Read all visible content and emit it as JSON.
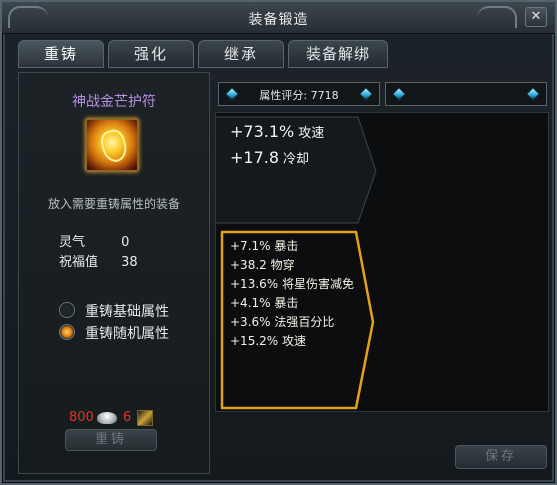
{
  "window": {
    "title": "装备锻造"
  },
  "tabs": [
    {
      "label": "重铸",
      "active": true
    },
    {
      "label": "强化",
      "active": false
    },
    {
      "label": "继承",
      "active": false
    },
    {
      "label": "装备解绑",
      "active": false
    }
  ],
  "item": {
    "name": "神战金芒护符",
    "icon": "golden-amulet-icon",
    "hint": "放入需要重铸属性的装备"
  },
  "stats": [
    {
      "label": "灵气",
      "value": "0"
    },
    {
      "label": "祝福值",
      "value": "38"
    }
  ],
  "options": [
    {
      "label": "重铸基础属性",
      "selected": false
    },
    {
      "label": "重铸随机属性",
      "selected": true
    }
  ],
  "cost": {
    "silver": "800",
    "stone": "6",
    "silver_icon": "silver-ingot-icon",
    "stone_icon": "reforge-stone-icon"
  },
  "reforge_button": "重铸",
  "score_bar": {
    "text": "属性评分: 7718"
  },
  "current_attrs": [
    {
      "value": "+73.1%",
      "name": "攻速"
    },
    {
      "value": "+17.8",
      "name": "冷却"
    }
  ],
  "new_attrs": [
    {
      "text": "+7.1%  暴击"
    },
    {
      "text": "+38.2  物穿"
    },
    {
      "text": "+13.6%  将星伤害减免"
    },
    {
      "text": "+4.1%  暴击"
    },
    {
      "text": "+3.6%  法强百分比"
    },
    {
      "text": "+15.2%  攻速"
    }
  ],
  "save_button": "保存",
  "colors": {
    "item_name": "#b68fe0",
    "cost_red": "#e0322b",
    "highlight_border": "#e4a018"
  }
}
